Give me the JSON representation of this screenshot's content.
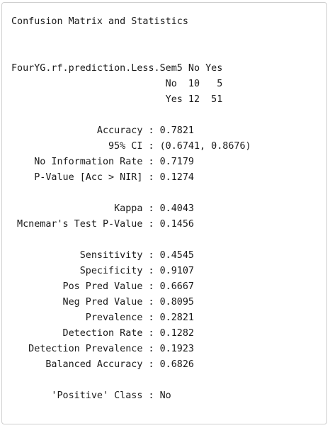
{
  "output": {
    "lines": [
      "Confusion Matrix and Statistics",
      "",
      "",
      "FourYG.rf.prediction.Less.Sem5 No Yes",
      "                           No  10   5",
      "                           Yes 12  51",
      "",
      "               Accuracy : 0.7821",
      "                 95% CI : (0.6741, 0.8676)",
      "    No Information Rate : 0.7179",
      "    P-Value [Acc > NIR] : 0.1274",
      "",
      "                  Kappa : 0.4043",
      " Mcnemar's Test P-Value : 0.1456",
      "",
      "            Sensitivity : 0.4545",
      "            Specificity : 0.9107",
      "         Pos Pred Value : 0.6667",
      "         Neg Pred Value : 0.8095",
      "             Prevalence : 0.2821",
      "         Detection Rate : 0.1282",
      "   Detection Prevalence : 0.1923",
      "      Balanced Accuracy : 0.6826",
      "",
      "       'Positive' Class : No"
    ]
  }
}
